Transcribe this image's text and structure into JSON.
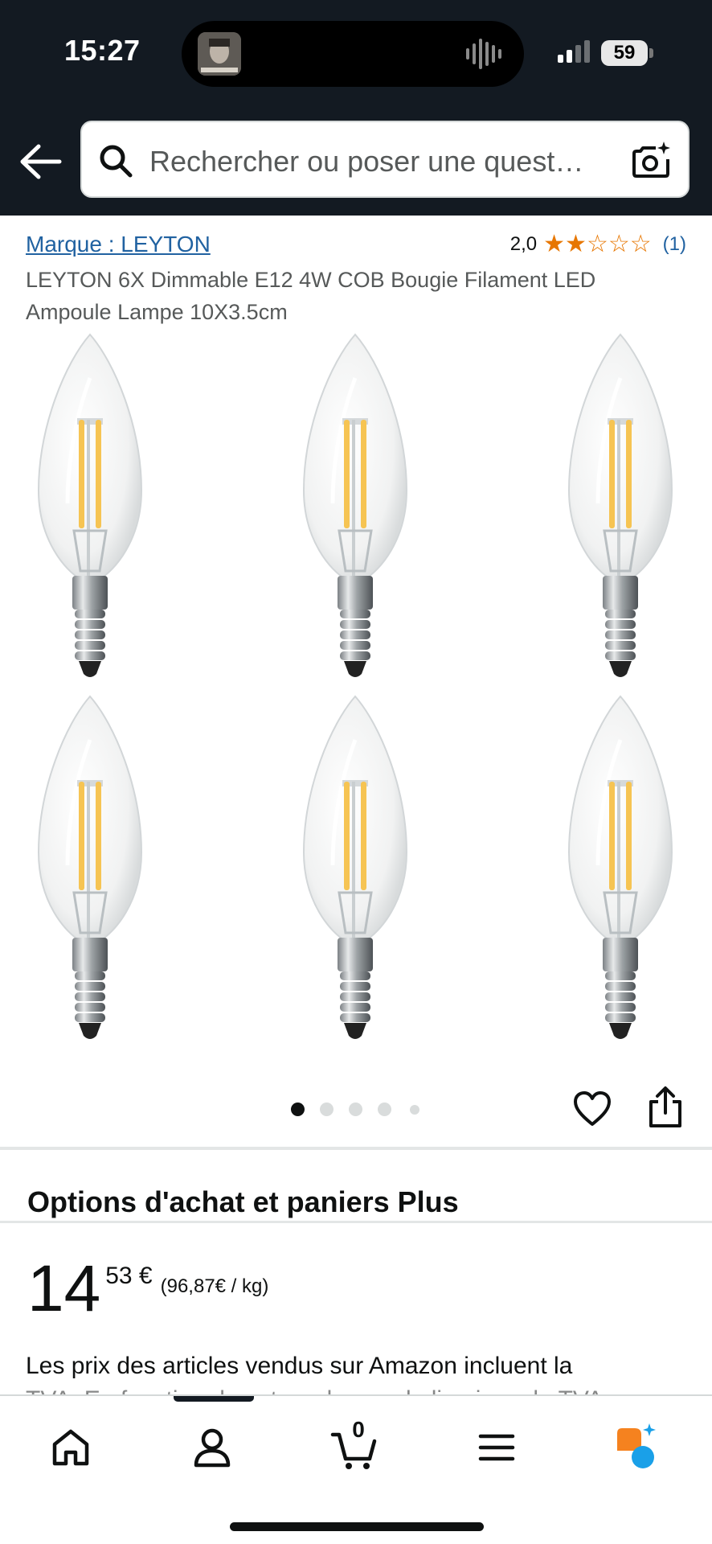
{
  "status_bar": {
    "time": "15:27",
    "battery": "59"
  },
  "search": {
    "placeholder": "Rechercher ou poser une quest…"
  },
  "product": {
    "brand_link": "Marque : LEYTON",
    "rating_value": "2,0",
    "rating_stars": 2,
    "rating_max": 5,
    "rating_count": "(1)",
    "title": "LEYTON 6X Dimmable E12 4W COB Bougie Filament LED Ampoule Lampe 10X3.5cm",
    "image_count": 5,
    "active_image": 1
  },
  "options": {
    "heading": "Options d'achat et paniers Plus"
  },
  "price": {
    "whole": "14",
    "fraction": "53 €",
    "unit_price": "(96,87€ / kg)"
  },
  "vat_notice": {
    "line1": "Les prix des articles vendus sur Amazon incluent la",
    "line2": "TVA. En fonction de votre adresse de livraison, la TVA"
  },
  "bottom_nav": {
    "cart_count": "0",
    "items": [
      "home-icon",
      "account-icon",
      "cart-icon",
      "menu-icon",
      "rufus-icon"
    ]
  },
  "colors": {
    "header_bg": "#131a22",
    "link": "#2162a1",
    "star": "#e77600",
    "rufus_orange": "#f5821f",
    "rufus_blue": "#1aa0e8"
  }
}
